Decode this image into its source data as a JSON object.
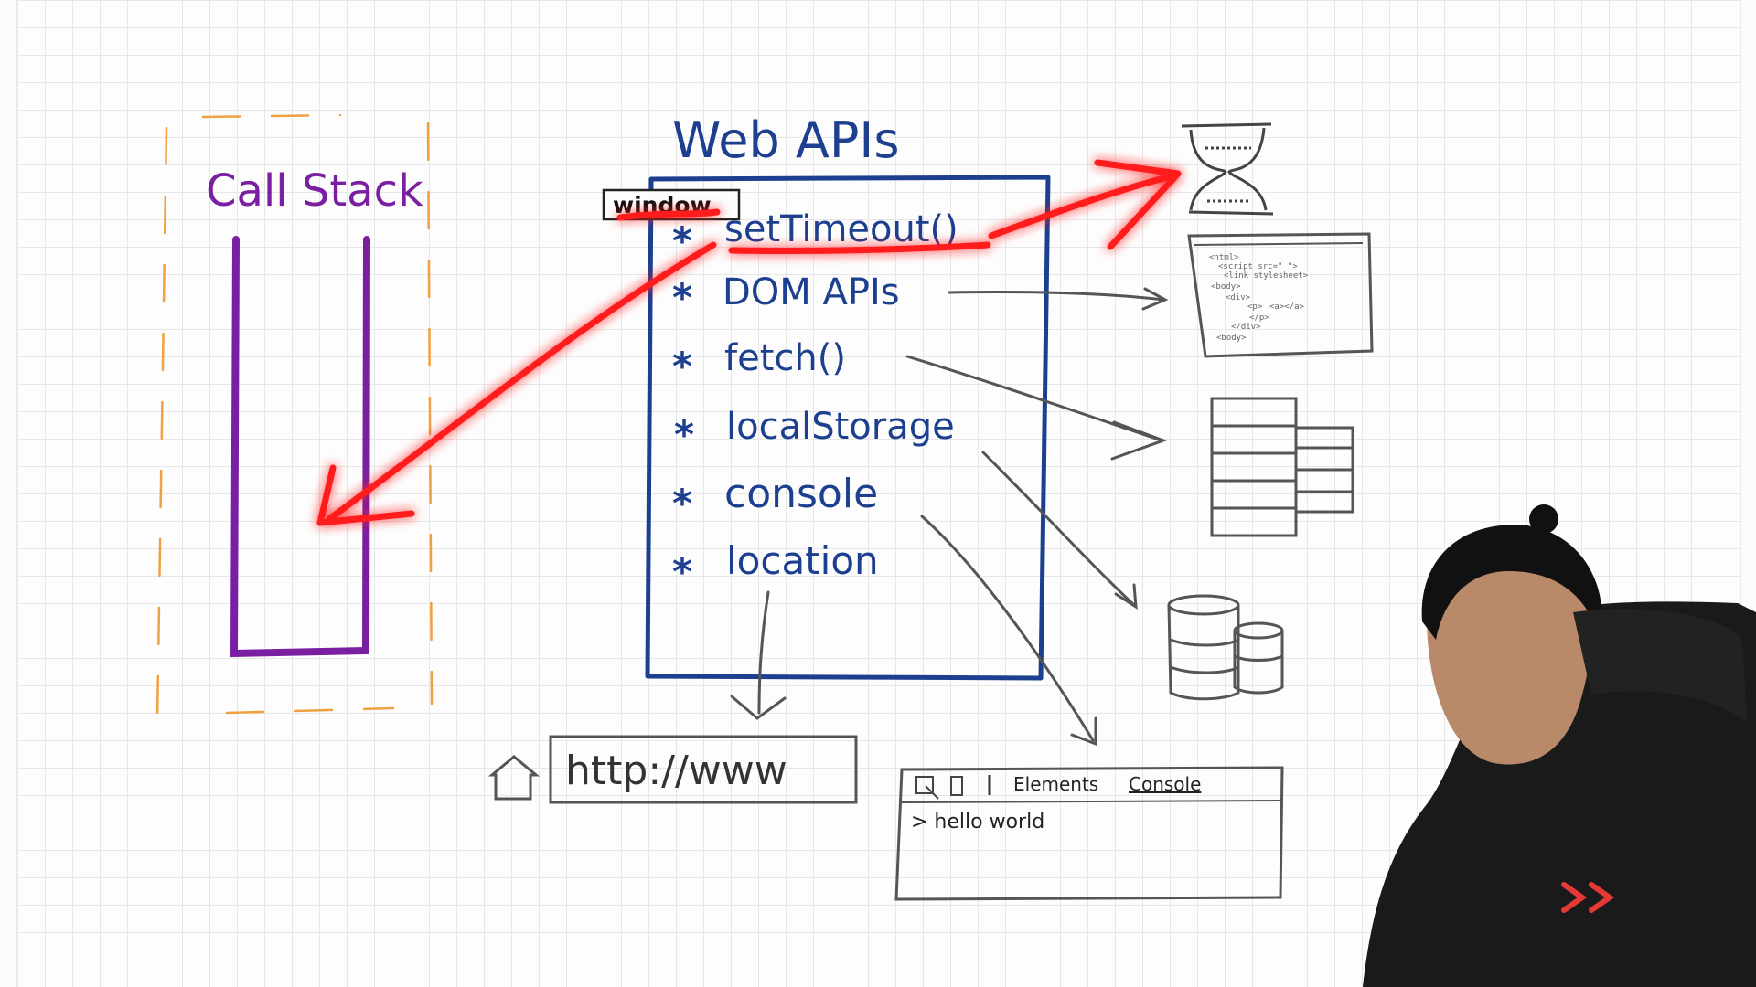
{
  "call_stack": {
    "title": "Call Stack"
  },
  "web_apis": {
    "title": "Web APIs",
    "window_tag": "window",
    "items": [
      {
        "bullet": "*",
        "label": "setTimeout()"
      },
      {
        "bullet": "*",
        "label": "DOM APIs"
      },
      {
        "bullet": "*",
        "label": "fetch()"
      },
      {
        "bullet": "*",
        "label": "localStorage"
      },
      {
        "bullet": "*",
        "label": "console"
      },
      {
        "bullet": "*",
        "label": "location"
      }
    ]
  },
  "url_bar": {
    "text": "http://www"
  },
  "devtools": {
    "tabs": [
      "Elements",
      "Console"
    ],
    "active_tab": "Console",
    "console_output": "> hello world"
  },
  "html_doc": {
    "lines": [
      "<html>",
      "<script src=\"  \">",
      "<link stylesheet>",
      "<body>",
      "<div>",
      "<p>",
      "<a></a>",
      "</p>",
      "</div>",
      "<body>"
    ]
  },
  "colors": {
    "call_stack": "#7b1fa2",
    "web_apis": "#1d3f8f",
    "highlight": "#ff1a1a",
    "sketch": "#555555",
    "dashed": "#f0a040"
  }
}
